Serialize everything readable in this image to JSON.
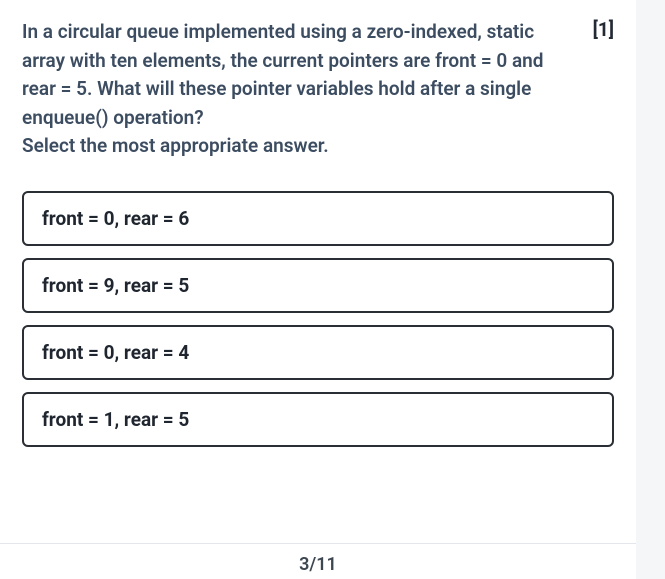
{
  "question": {
    "stem": "In a circular queue implemented using a zero-indexed, static array with ten elements, the current pointers are front = 0 and rear = 5. What will these pointer variables hold after a single enqueue() operation?",
    "instruction": "Select the most appropriate answer.",
    "marks": "[1]"
  },
  "options": [
    {
      "label": "front = 0, rear = 6"
    },
    {
      "label": "front = 9, rear = 5"
    },
    {
      "label": "front = 0, rear = 4"
    },
    {
      "label": "front = 1, rear = 5"
    }
  ],
  "pagination": {
    "label": "3/11"
  }
}
